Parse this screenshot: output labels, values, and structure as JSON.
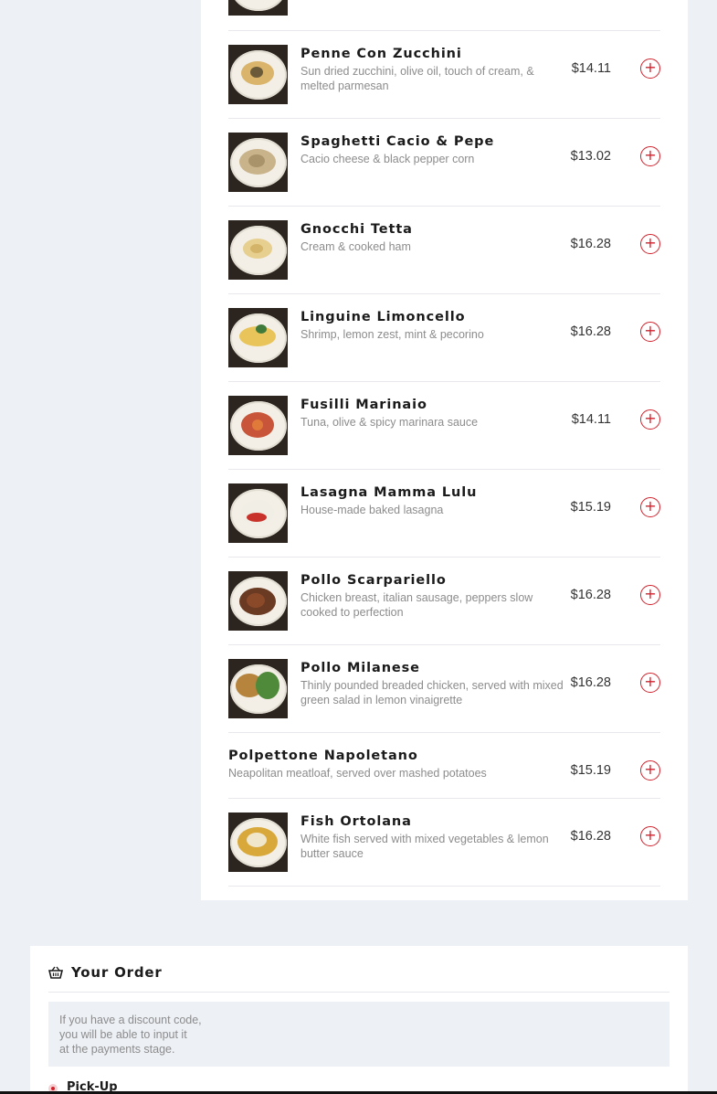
{
  "menu": {
    "items": [
      {
        "name": "Penne Con Zucchini",
        "desc": "Sun dried zucchini, olive oil, touch of cream, & melted parmesan",
        "price": "$14.11",
        "image": "dish-photo"
      },
      {
        "name": "Spaghetti Cacio & Pepe",
        "desc": "Cacio cheese & black pepper corn",
        "price": "$13.02",
        "image": "dish-photo"
      },
      {
        "name": "Gnocchi Tetta",
        "desc": "Cream & cooked ham",
        "price": "$16.28",
        "image": "dish-photo"
      },
      {
        "name": "Linguine Limoncello",
        "desc": "Shrimp, lemon zest, mint & pecorino",
        "price": "$16.28",
        "image": "dish-photo"
      },
      {
        "name": "Fusilli Marinaio",
        "desc": "Tuna, olive & spicy marinara sauce",
        "price": "$14.11",
        "image": "dish-photo"
      },
      {
        "name": "Lasagna Mamma Lulu",
        "desc": "House-made baked lasagna",
        "price": "$15.19",
        "image": "dish-photo"
      },
      {
        "name": "Pollo Scarpariello",
        "desc": "Chicken breast, italian sausage, peppers slow cooked to perfection",
        "price": "$16.28",
        "image": "dish-photo"
      },
      {
        "name": "Pollo Milanese",
        "desc": "Thinly pounded breaded chicken, served with mixed green salad in lemon vinaigrette",
        "price": "$16.28",
        "image": "dish-photo"
      },
      {
        "name": "Polpettone Napoletano",
        "desc": "Neapolitan meatloaf, served over mashed potatoes",
        "price": "$15.19",
        "image": ""
      },
      {
        "name": "Fish Ortolana",
        "desc": "White fish served with mixed vegetables & lemon butter sauce",
        "price": "$16.28",
        "image": "dish-photo"
      }
    ],
    "add_icon": "plus-circle-icon"
  },
  "order": {
    "title": "Your Order",
    "icon": "basket-icon",
    "discount_lines": [
      "If you have a discount code,",
      "you will be able to input it",
      "at the payments stage."
    ],
    "pickup_label": "Pick-Up"
  },
  "colors": {
    "accent": "#d0212b",
    "page_bg": "#edf0f5",
    "card_bg": "#ffffff"
  }
}
